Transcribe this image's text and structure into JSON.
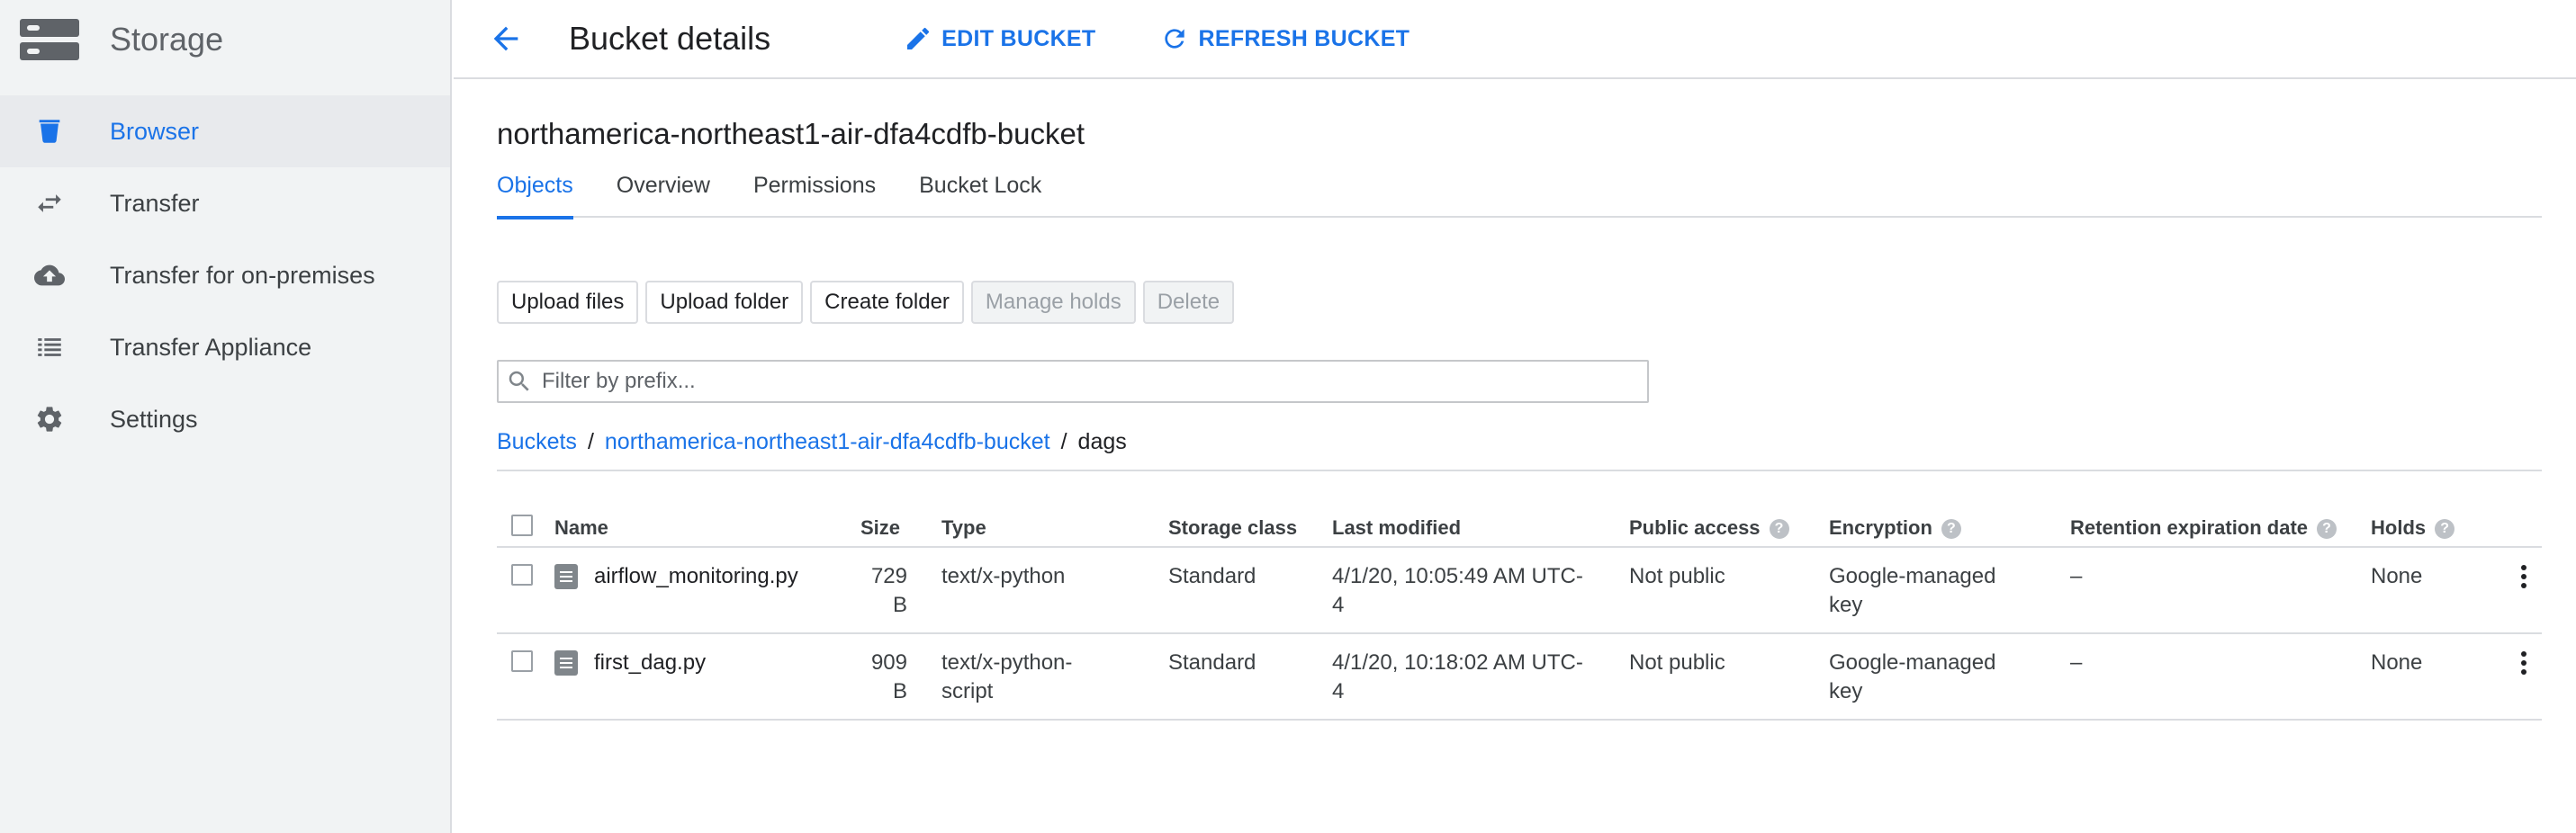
{
  "sidebar": {
    "title": "Storage",
    "items": [
      {
        "label": "Browser",
        "icon": "bucket-icon"
      },
      {
        "label": "Transfer",
        "icon": "transfer-arrows-icon"
      },
      {
        "label": "Transfer for on-premises",
        "icon": "cloud-upload-icon"
      },
      {
        "label": "Transfer Appliance",
        "icon": "list-icon"
      },
      {
        "label": "Settings",
        "icon": "gear-icon"
      }
    ]
  },
  "header": {
    "title": "Bucket details",
    "edit_label": "EDIT BUCKET",
    "refresh_label": "REFRESH BUCKET"
  },
  "bucket": {
    "name": "northamerica-northeast1-air-dfa4cdfb-bucket"
  },
  "tabs": [
    {
      "label": "Objects"
    },
    {
      "label": "Overview"
    },
    {
      "label": "Permissions"
    },
    {
      "label": "Bucket Lock"
    }
  ],
  "toolbar": {
    "upload_files": "Upload files",
    "upload_folder": "Upload folder",
    "create_folder": "Create folder",
    "manage_holds": "Manage holds",
    "delete": "Delete"
  },
  "filter": {
    "placeholder": "Filter by prefix..."
  },
  "breadcrumb": {
    "root": "Buckets",
    "bucket": "northamerica-northeast1-air-dfa4cdfb-bucket",
    "current": "dags",
    "separator": "/"
  },
  "table": {
    "columns": {
      "name": "Name",
      "size": "Size",
      "type": "Type",
      "storage_class": "Storage class",
      "last_modified": "Last modified",
      "public_access": "Public access",
      "encryption": "Encryption",
      "retention": "Retention expiration date",
      "holds": "Holds"
    },
    "rows": [
      {
        "name": "airflow_monitoring.py",
        "size": "729 B",
        "type": "text/x-python",
        "storage_class": "Standard",
        "last_modified": "4/1/20, 10:05:49 AM UTC-4",
        "public_access": "Not public",
        "encryption": "Google-managed key",
        "retention": "–",
        "holds": "None"
      },
      {
        "name": "first_dag.py",
        "size": "909 B",
        "type": "text/x-python-script",
        "storage_class": "Standard",
        "last_modified": "4/1/20, 10:18:02 AM UTC-4",
        "public_access": "Not public",
        "encryption": "Google-managed key",
        "retention": "–",
        "holds": "None"
      }
    ]
  },
  "colors": {
    "accent": "#1a73e8",
    "sidebar_bg": "#f1f3f4",
    "active_item_bg": "#e8eaed",
    "icon_gray": "#5f6368",
    "border": "#dadce0"
  }
}
